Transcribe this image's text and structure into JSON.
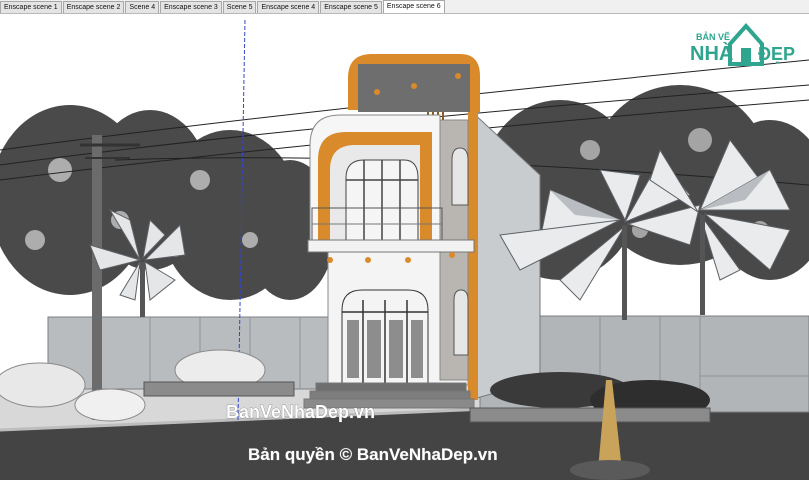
{
  "tabs": [
    {
      "label": "Enscape scene 1"
    },
    {
      "label": "Enscape scene 2"
    },
    {
      "label": "Scene 4"
    },
    {
      "label": "Enscape scene 3"
    },
    {
      "label": "Scene 5"
    },
    {
      "label": "Enscape scene 4"
    },
    {
      "label": "Enscape scene 5"
    },
    {
      "label": "Enscape scene 6",
      "active": true
    }
  ],
  "logo": {
    "top": "BẢN VẼ",
    "left": "NHÀ",
    "right": "ĐẸP"
  },
  "watermark": {
    "center": "BanVeNhaDep.vn",
    "bottom": "Bản quyền © BanVeNhaDep.vn"
  },
  "colors": {
    "accent_orange": "#d98a2a",
    "logo_green": "#2fa58f"
  }
}
